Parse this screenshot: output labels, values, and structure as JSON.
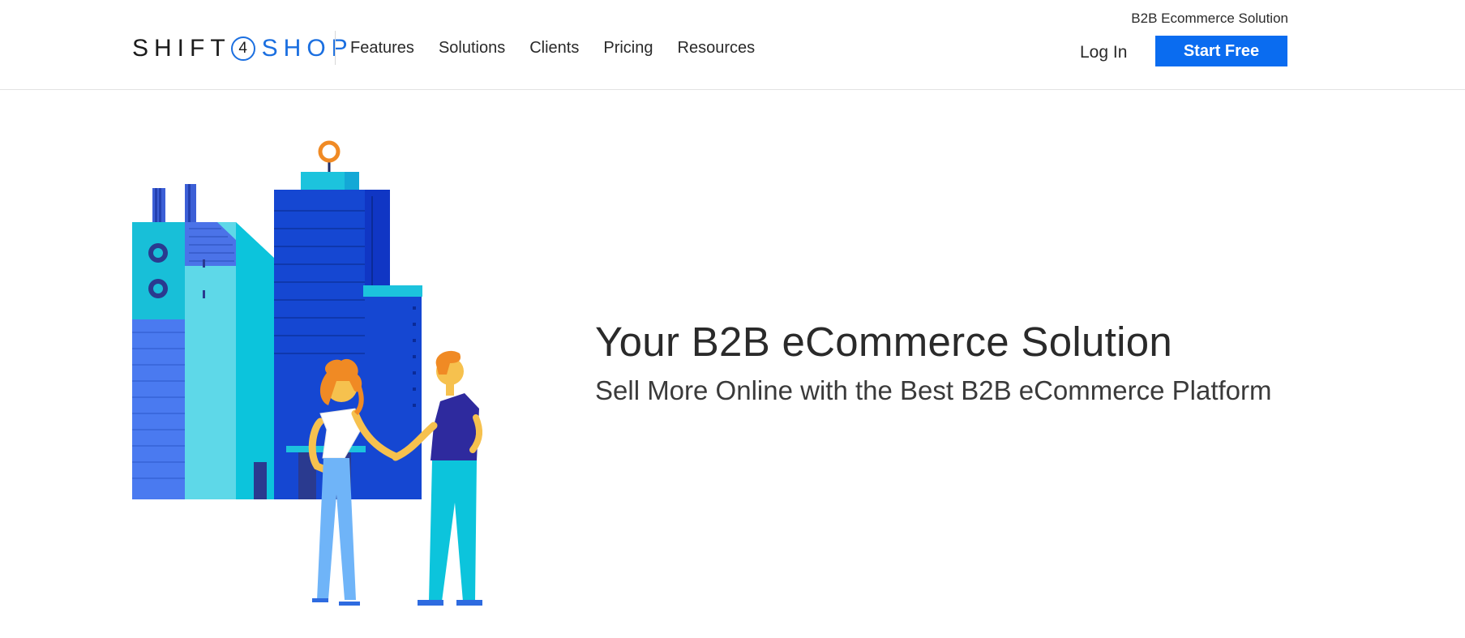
{
  "header": {
    "logo": {
      "part1": "SHIFT",
      "number": "4",
      "part2": "SHOP"
    },
    "nav": [
      {
        "label": "Features"
      },
      {
        "label": "Solutions"
      },
      {
        "label": "Clients"
      },
      {
        "label": "Pricing"
      },
      {
        "label": "Resources"
      }
    ],
    "top_link": "B2B Ecommerce Solution",
    "login_label": "Log In",
    "cta_label": "Start Free"
  },
  "hero": {
    "title": "Your B2B eCommerce Solution",
    "subtitle": "Sell More Online with the Best B2B eCommerce Platform",
    "illustration": "buildings-handshake-illustration"
  },
  "colors": {
    "brand_blue": "#1b6fe0",
    "cta_blue": "#0a6cf0"
  }
}
